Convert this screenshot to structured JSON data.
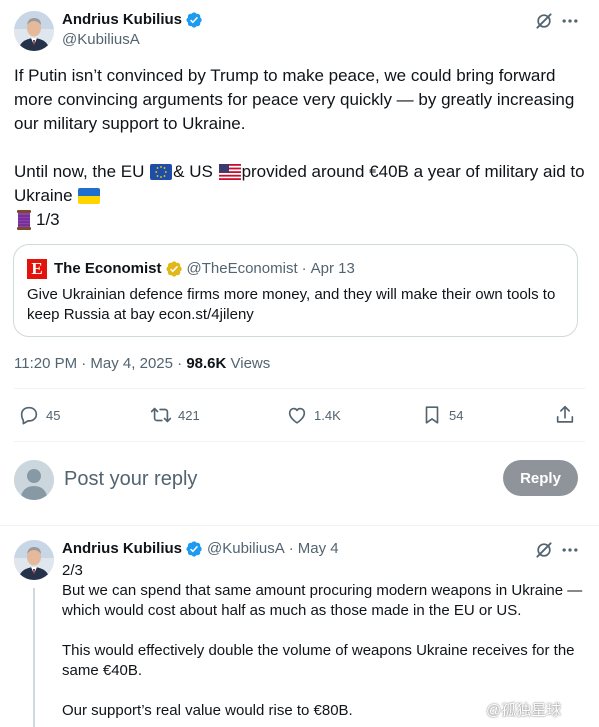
{
  "main_tweet": {
    "author": {
      "display_name": "Andrius Kubilius",
      "handle": "@KubiliusA",
      "verified": true
    },
    "text_paragraph_1": "If Putin isn’t convinced by Trump to make peace, we could bring forward more convincing arguments for peace very quickly — by greatly increasing our military support to Ukraine.",
    "text_paragraph_2": {
      "part_a": "Until now, the EU",
      "part_b": "& US",
      "part_c": "provided around €40B a year of military aid to Ukraine",
      "flags": [
        "eu-flag",
        "us-flag",
        "ukraine-flag"
      ]
    },
    "thread_counter": "1/3",
    "thread_icon": "spool-of-thread-icon",
    "quote": {
      "display_name": "The Economist",
      "handle": "@TheEconomist",
      "separator": "·",
      "date": "Apr 13",
      "logo_letter": "E",
      "text": "Give Ukrainian defence firms more money, and they will make their own tools to keep Russia at bay econ.st/4jileny"
    },
    "timestamp": "11:20 PM · May 4, 2025 · ",
    "views_count": "98.6K",
    "views_label": " Views",
    "actions": {
      "replies": "45",
      "reposts": "421",
      "likes": "1.4K",
      "bookmarks": "54"
    }
  },
  "reply_composer": {
    "placeholder": "Post your reply",
    "button_label": "Reply"
  },
  "second_tweet": {
    "author": {
      "display_name": "Andrius Kubilius",
      "handle": "@KubiliusA",
      "separator": "·",
      "date": "May 4"
    },
    "counter": "2/3",
    "paragraph_1": "But we can spend that same amount procuring modern weapons in Ukraine — which would cost about half as much as those made in the EU or US.",
    "paragraph_2": "This would effectively double the volume of weapons Ukraine receives for the same €40B.",
    "paragraph_3": "Our support’s real value would rise to €80B."
  },
  "watermark": {
    "text": "@孤独星球"
  },
  "colors": {
    "text_primary": "#0f1419",
    "text_secondary": "#536471",
    "verified_blue": "#1d9bf0",
    "economist_red": "#e3120b",
    "business_gold": "#e2b719",
    "reply_button_bg": "#8e9499",
    "border": "#cfd9de"
  }
}
